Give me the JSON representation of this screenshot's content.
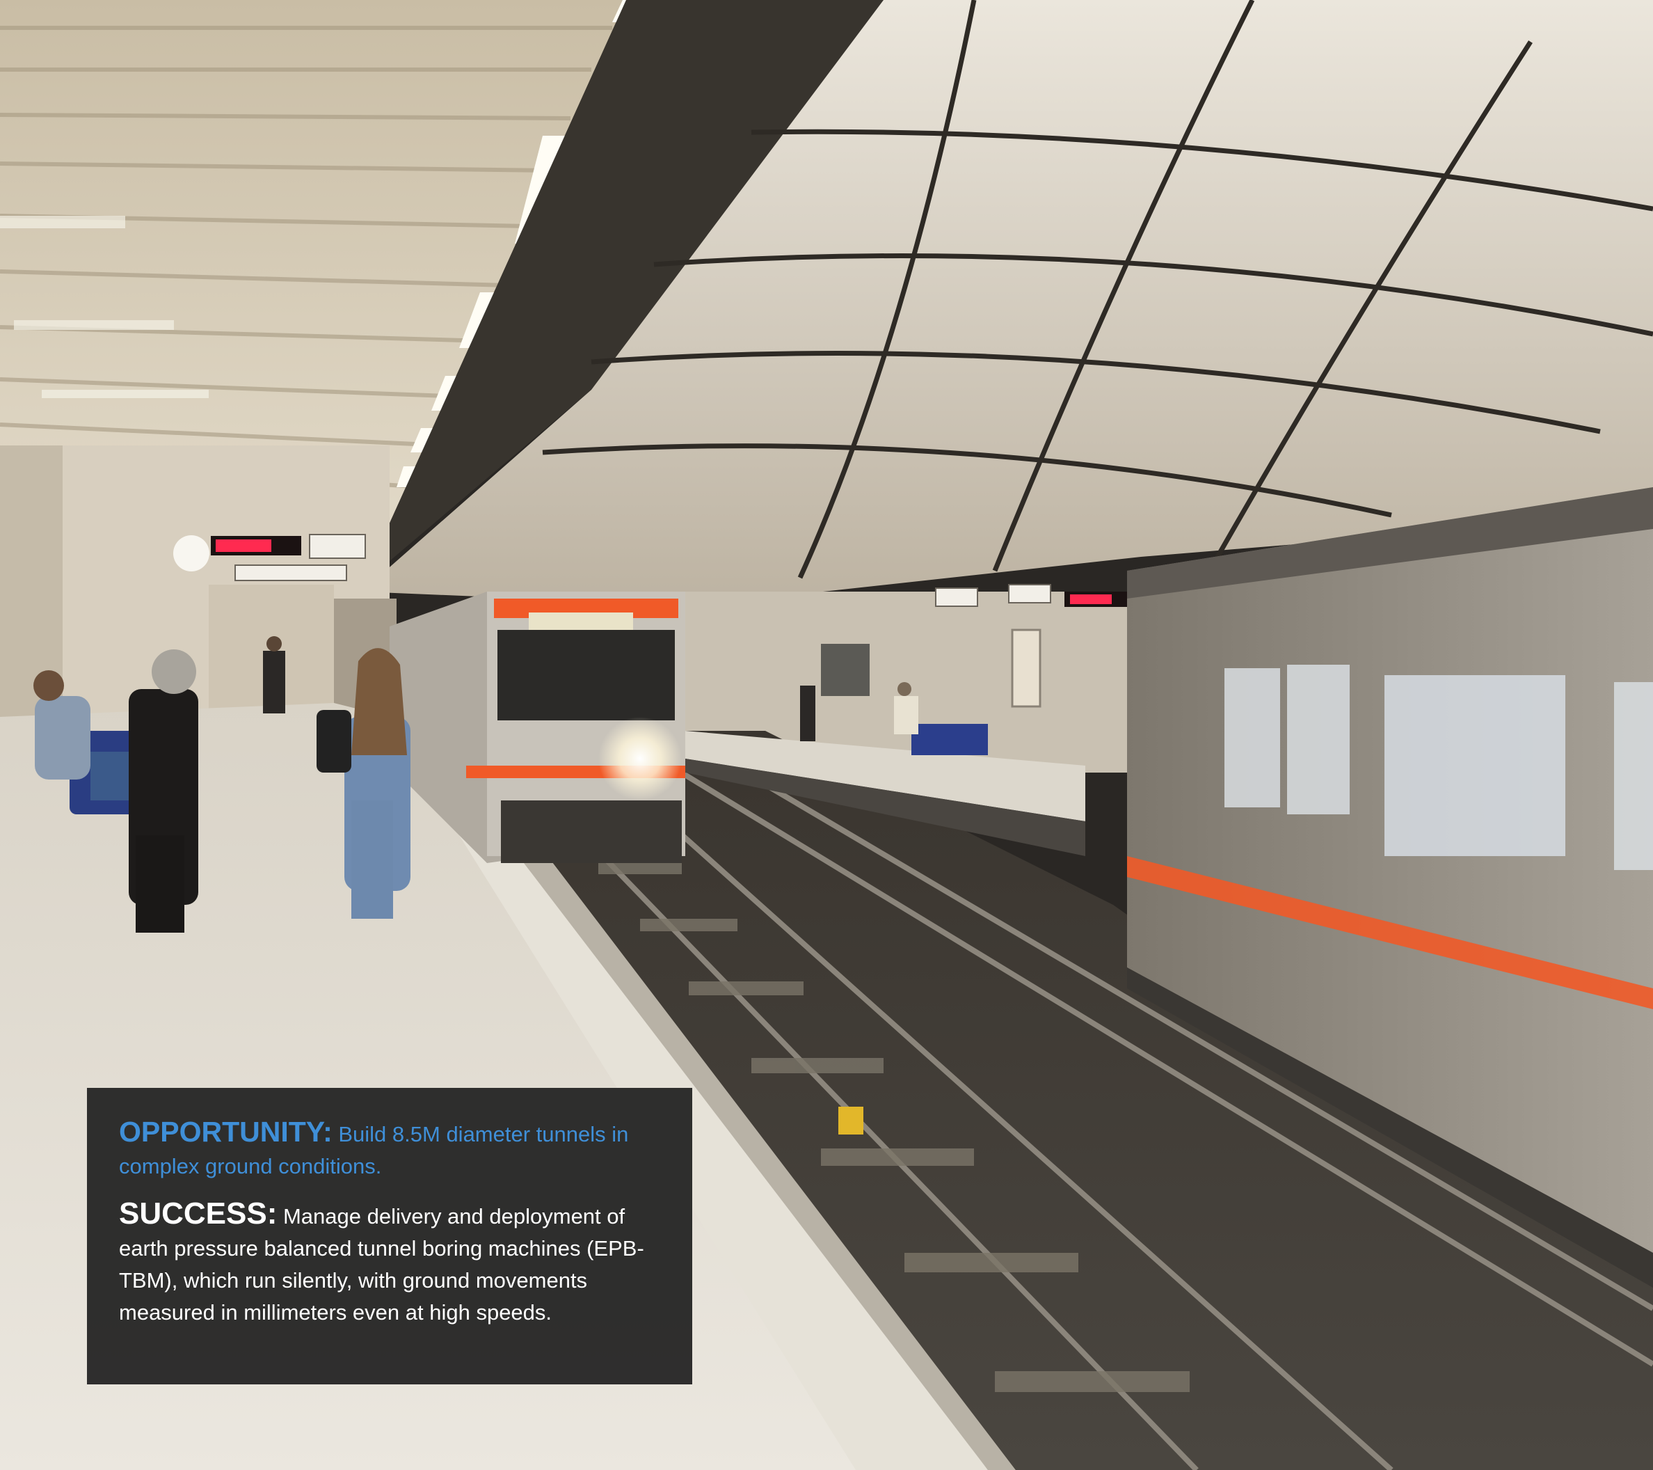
{
  "caption": {
    "opportunity_label": "OPPORTUNITY:",
    "opportunity_text": " Build 8.5M diameter tunnels in complex ground conditions.",
    "success_label": "SUCCESS:",
    "success_text": " Manage delivery and deployment of earth pressure balanced tunnel boring machines (EPB-TBM), which run silently, with ground movements measured in millimeters even at high speeds."
  },
  "colors": {
    "accent_blue": "#3f8fd8",
    "caption_background": "#1e1e1e",
    "train_stripe": "#f05a28"
  }
}
